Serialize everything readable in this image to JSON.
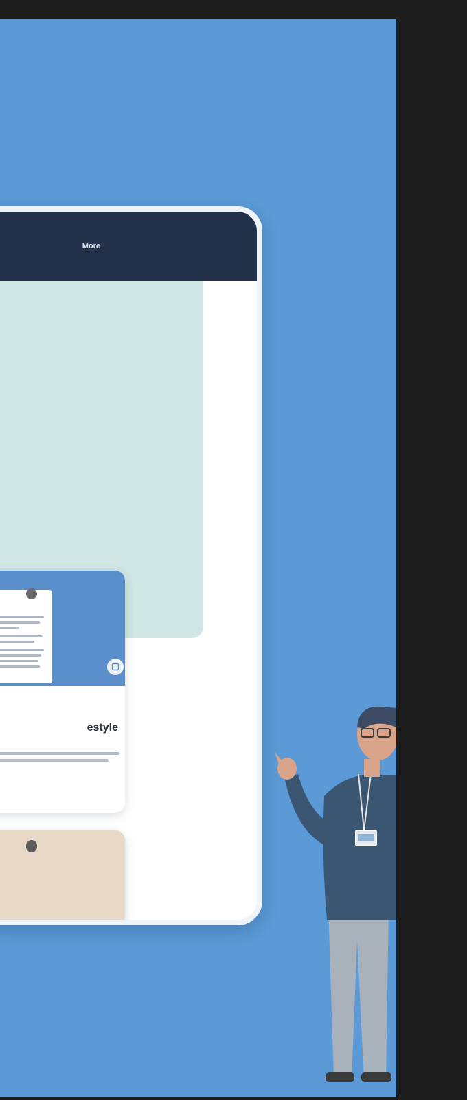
{
  "header": {
    "nav_items": [
      {
        "label": "More"
      },
      {
        "label": ""
      }
    ]
  },
  "card": {
    "badge": "",
    "title": "estyle",
    "description": ""
  },
  "card2": {
    "badge": ""
  },
  "colors": {
    "background": "#5b9ad6",
    "header": "#23324a",
    "hero": "#cfe6e4",
    "card_thumb": "#5b8fcc",
    "card2": "#e8d8c6",
    "badge": "#6b6b6b"
  },
  "icons": {
    "card_action": "save-icon"
  }
}
